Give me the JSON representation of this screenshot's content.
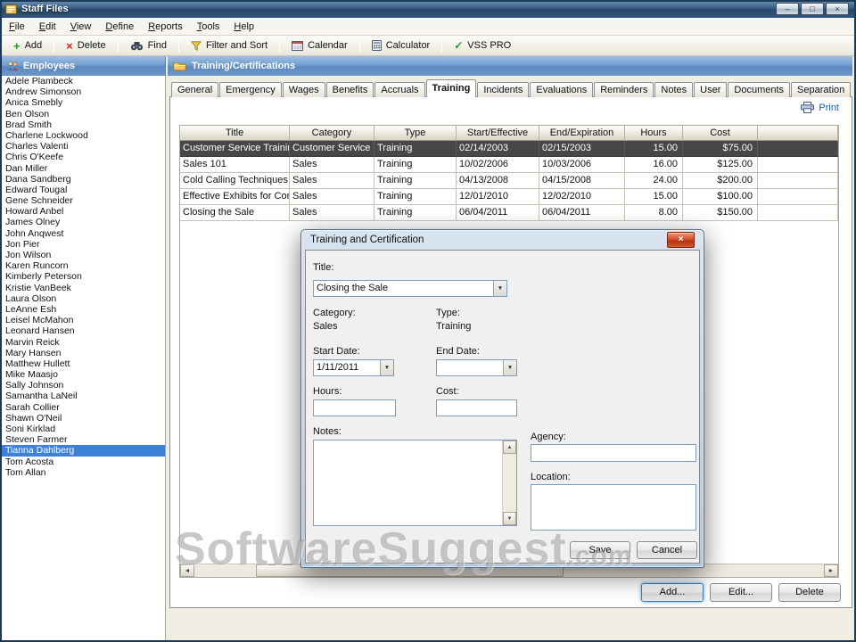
{
  "window": {
    "title": "Staff Files"
  },
  "icons": {
    "minimize": "–",
    "maximize": "□",
    "close": "×",
    "dropdown": "▼",
    "scroll_left": "◄",
    "scroll_right": "►",
    "scroll_up": "▲",
    "scroll_down": "▼",
    "add": "+",
    "delete": "×",
    "check": "✓"
  },
  "menu": {
    "items": [
      "File",
      "Edit",
      "View",
      "Define",
      "Reports",
      "Tools",
      "Help"
    ]
  },
  "toolbar": {
    "items": [
      {
        "label": "Add",
        "icon": "add-icon"
      },
      {
        "label": "Delete",
        "icon": "delete-icon"
      },
      {
        "label": "Find",
        "icon": "find-icon"
      },
      {
        "label": "Filter and Sort",
        "icon": "filter-icon"
      },
      {
        "label": "Calendar",
        "icon": "calendar-icon"
      },
      {
        "label": "Calculator",
        "icon": "calculator-icon"
      },
      {
        "label": "VSS PRO",
        "icon": "vss-icon"
      }
    ]
  },
  "sidebar": {
    "title": "Employees",
    "selected_index": 34,
    "employees": [
      "Adele Plambeck",
      "Andrew Simonson",
      "Anica Smebly",
      "Ben Olson",
      "Brad Smith",
      "Charlene Lockwood",
      "Charles Valenti",
      "Chris O'Keefe",
      "Dan Miller",
      "Dana Sandberg",
      "Edward Tougal",
      "Gene Schneider",
      "Howard Anbel",
      "James Olney",
      "John Anqwest",
      "Jon Pier",
      "Jon Wilson",
      "Karen Runcorn",
      "Kimberly Peterson",
      "Kristie VanBeek",
      "Laura Olson",
      "LeAnne Esh",
      "Leisel McMahon",
      "Leonard Hansen",
      "Marvin Reick",
      "Mary Hansen",
      "Matthew Hullett",
      "Mike Maasjo",
      "Sally Johnson",
      "Samantha LaNeil",
      "Sarah Collier",
      "Shawn O'Neil",
      "Soni Kirklad",
      "Steven Farmer",
      "Tianna Dahlberg",
      "Tom Acosta",
      "Tom Allan"
    ]
  },
  "main": {
    "title": "Training/Certifications",
    "tabs": [
      "General",
      "Emergency",
      "Wages",
      "Benefits",
      "Accruals",
      "Training",
      "Incidents",
      "Evaluations",
      "Reminders",
      "Notes",
      "User",
      "Documents",
      "Separation"
    ],
    "active_tab": "Training",
    "print_label": "Print",
    "table": {
      "columns": [
        "Title",
        "Category",
        "Type",
        "Start/Effective",
        "End/Expiration",
        "Hours",
        "Cost"
      ],
      "selected_row": 0,
      "rows": [
        [
          "Customer Service Training",
          "Customer Service",
          "Training",
          "02/14/2003",
          "02/15/2003",
          "15.00",
          "$75.00"
        ],
        [
          "Sales 101",
          "Sales",
          "Training",
          "10/02/2006",
          "10/03/2006",
          "16.00",
          "$125.00"
        ],
        [
          "Cold Calling Techniques",
          "Sales",
          "Training",
          "04/13/2008",
          "04/15/2008",
          "24.00",
          "$200.00"
        ],
        [
          "Effective Exhibits for Con...",
          "Sales",
          "Training",
          "12/01/2010",
          "12/02/2010",
          "15.00",
          "$100.00"
        ],
        [
          "Closing the Sale",
          "Sales",
          "Training",
          "06/04/2011",
          "06/04/2011",
          "8.00",
          "$150.00"
        ]
      ]
    },
    "buttons": {
      "add": "Add...",
      "edit": "Edit...",
      "delete": "Delete"
    }
  },
  "dialog": {
    "title": "Training and Certification",
    "fields": {
      "title_label": "Title:",
      "title_value": "Closing the Sale",
      "category_label": "Category:",
      "category_value": "Sales",
      "type_label": "Type:",
      "type_value": "Training",
      "start_date_label": "Start Date:",
      "start_date_value": "1/11/2011",
      "end_date_label": "End Date:",
      "end_date_value": "",
      "hours_label": "Hours:",
      "hours_value": "",
      "cost_label": "Cost:",
      "cost_value": "",
      "notes_label": "Notes:",
      "notes_value": "",
      "agency_label": "Agency:",
      "agency_value": "",
      "location_label": "Location:",
      "location_value": ""
    },
    "buttons": {
      "save": "Save",
      "cancel": "Cancel"
    }
  },
  "watermark": {
    "text": "SoftwareSuggest",
    "suffix": ".com"
  }
}
